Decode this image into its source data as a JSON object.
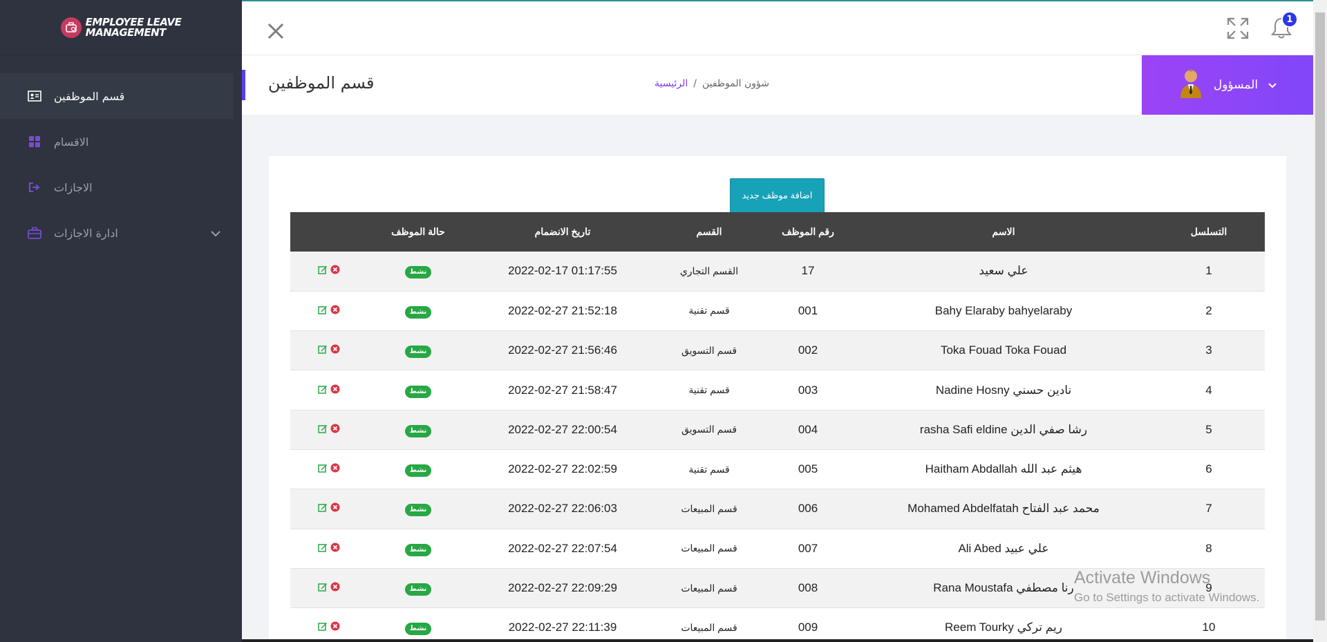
{
  "brand": {
    "line1": "Employee Leave",
    "line2": "Management"
  },
  "sidebar": {
    "items": [
      {
        "label": "قسم الموظفين",
        "icon": "id-card-icon",
        "active": true
      },
      {
        "label": "الاقسام",
        "icon": "grid-icon",
        "active": false
      },
      {
        "label": "الاجازات",
        "icon": "sign-out-icon",
        "active": false
      },
      {
        "label": "ادارة الاجازات",
        "icon": "briefcase-icon",
        "active": false,
        "expandable": true
      }
    ]
  },
  "topbar": {
    "notifications_count": "1"
  },
  "page": {
    "title": "قسم الموظفين",
    "breadcrumb": {
      "current": "شؤون الموظفين",
      "separator": "/",
      "home": "الرئيسية"
    },
    "user": {
      "name": "المسؤول"
    }
  },
  "table": {
    "add_button": "اضافة موظف جديد",
    "headers": {
      "actions": "",
      "status": "حالة الموظف",
      "date": "تاريخ الانضمام",
      "dept": "القسم",
      "emp_no": "رقم الموظف",
      "name": "الاسم",
      "seq": "التسلسل"
    },
    "rows": [
      {
        "status": "نشط",
        "date": "2022-02-17 01:17:55",
        "dept": "القسم التجاري",
        "emp_no": "17",
        "name": "علي سعيد",
        "seq": "1"
      },
      {
        "status": "نشط",
        "date": "2022-02-27 21:52:18",
        "dept": "قسم تقنية",
        "emp_no": "001",
        "name": "Bahy Elaraby bahyelaraby",
        "seq": "2"
      },
      {
        "status": "نشط",
        "date": "2022-02-27 21:56:46",
        "dept": "قسم التسويق",
        "emp_no": "002",
        "name": "Toka Fouad Toka Fouad",
        "seq": "3"
      },
      {
        "status": "نشط",
        "date": "2022-02-27 21:58:47",
        "dept": "قسم تقنية",
        "emp_no": "003",
        "name": "Nadine Hosny نادين حسني",
        "seq": "4"
      },
      {
        "status": "نشط",
        "date": "2022-02-27 22:00:54",
        "dept": "قسم التسويق",
        "emp_no": "004",
        "name": "rasha Safi eldine رشا صفي الدين",
        "seq": "5"
      },
      {
        "status": "نشط",
        "date": "2022-02-27 22:02:59",
        "dept": "قسم تقنية",
        "emp_no": "005",
        "name": "Haitham Abdallah هيثم عبد الله",
        "seq": "6"
      },
      {
        "status": "نشط",
        "date": "2022-02-27 22:06:03",
        "dept": "قسم المبيعات",
        "emp_no": "006",
        "name": "Mohamed Abdelfatah محمد عبد الفتاح",
        "seq": "7"
      },
      {
        "status": "نشط",
        "date": "2022-02-27 22:07:54",
        "dept": "قسم المبيعات",
        "emp_no": "007",
        "name": "Ali Abed علي عبيد",
        "seq": "8"
      },
      {
        "status": "نشط",
        "date": "2022-02-27 22:09:29",
        "dept": "قسم المبيعات",
        "emp_no": "008",
        "name": "Rana Moustafa رنا مصطفي",
        "seq": "9"
      },
      {
        "status": "نشط",
        "date": "2022-02-27 22:11:39",
        "dept": "قسم المبيعات",
        "emp_no": "009",
        "name": "Reem Tourky ريم تركي",
        "seq": "10"
      }
    ]
  },
  "watermark": {
    "title": "Activate Windows",
    "subtitle": "Go to Settings to activate Windows."
  },
  "colors": {
    "sidebar": "#2e333f",
    "accent": "#8147f8",
    "button": "#17a2b8",
    "badge": "#28a745",
    "table_head": "#434343"
  }
}
